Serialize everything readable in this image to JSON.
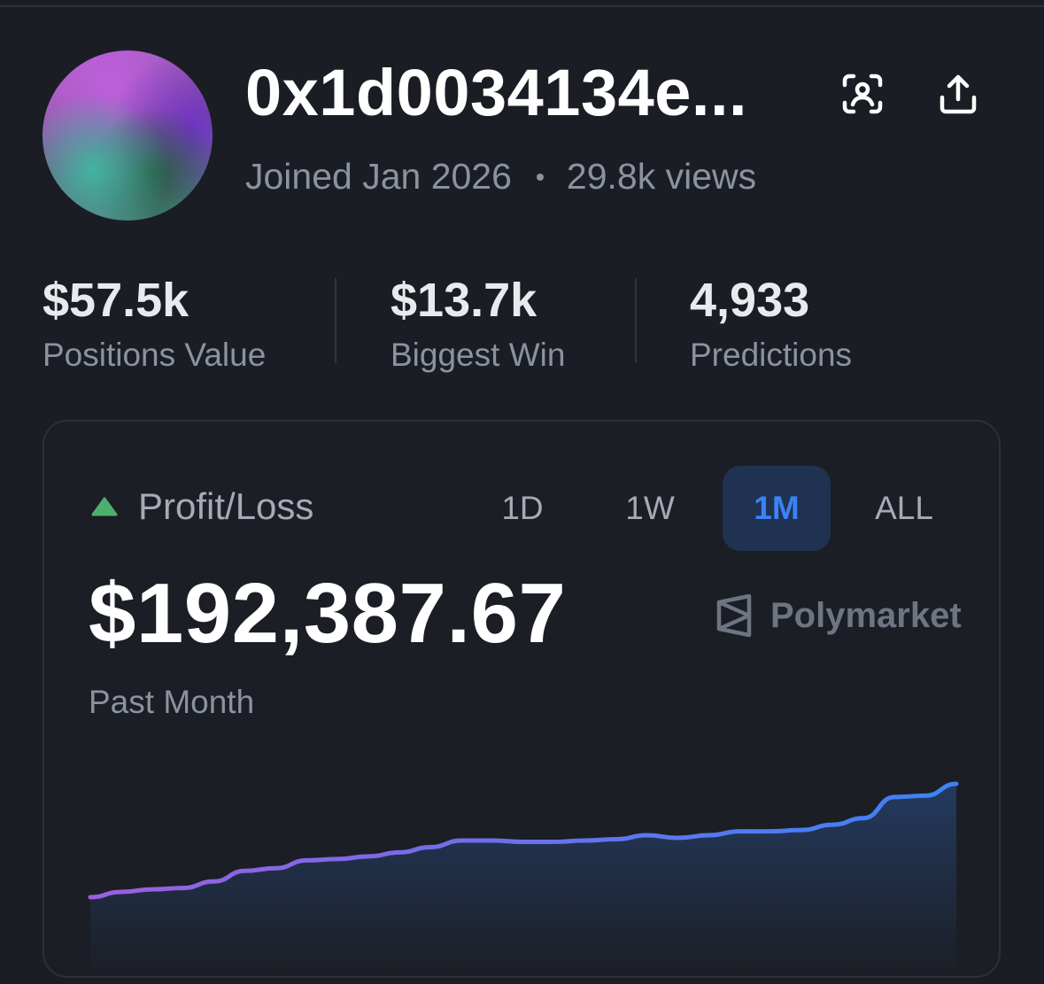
{
  "profile": {
    "username": "0x1d0034134e...",
    "joined": "Joined Jan 2026",
    "views": "29.8k views"
  },
  "icons": {
    "scan": "scan-user-icon",
    "share": "share-upload-icon",
    "trend": "triangle-up-icon",
    "brand_logo": "polymarket-logo-icon"
  },
  "stats": [
    {
      "value": "$57.5k",
      "label": "Positions Value"
    },
    {
      "value": "$13.7k",
      "label": "Biggest Win"
    },
    {
      "value": "4,933",
      "label": "Predictions"
    }
  ],
  "pnl": {
    "label": "Profit/Loss",
    "tabs": [
      "1D",
      "1W",
      "1M",
      "ALL"
    ],
    "active_tab": "1M",
    "amount": "$192,387.67",
    "period": "Past Month",
    "brand": "Polymarket"
  },
  "colors": {
    "background": "#1a1d23",
    "accent": "#3b82f6",
    "positive": "#4caf6e",
    "line_start": "#9b5fe0",
    "line_end": "#3b82f6"
  },
  "chart_data": {
    "type": "area",
    "title": "",
    "xlabel": "",
    "ylabel": "",
    "grid": false,
    "values": [
      0,
      4,
      6,
      7,
      12,
      20,
      22,
      28,
      29,
      31,
      34,
      38,
      43,
      43,
      42,
      42,
      43,
      44,
      47,
      45,
      47,
      50,
      50,
      51,
      55,
      60,
      76,
      77,
      86
    ]
  }
}
